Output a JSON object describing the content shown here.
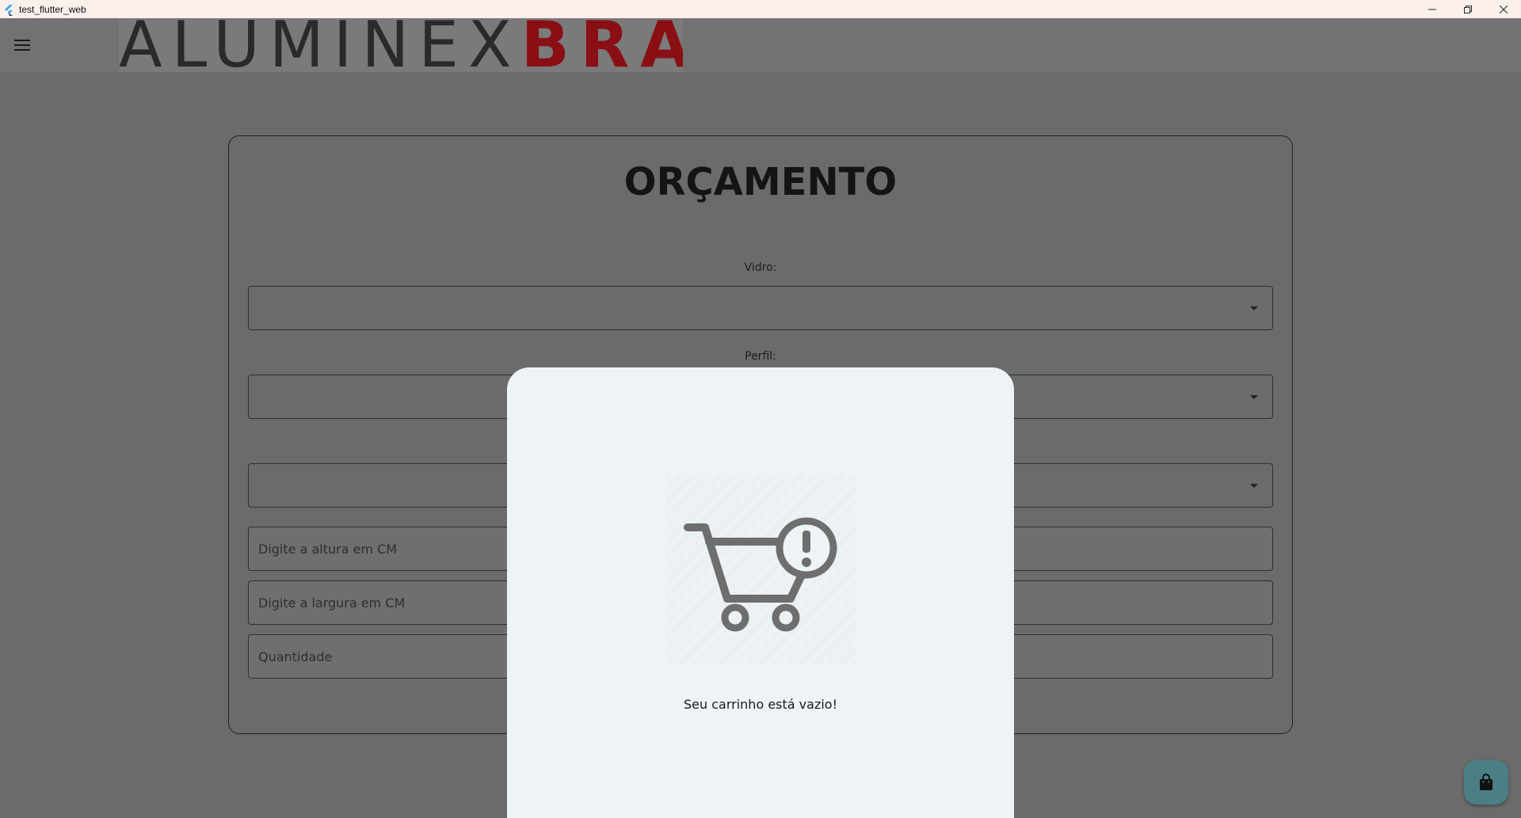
{
  "window": {
    "title": "test_flutter_web",
    "app_icon": "flutter-icon",
    "controls": [
      "minimize-icon",
      "restore-icon",
      "close-icon"
    ]
  },
  "appbar": {
    "menu_icon": "hamburger-menu-icon",
    "logo": {
      "part1": "ALUMINEX",
      "part2": "BRASIL"
    }
  },
  "form": {
    "title": "ORÇAMENTO",
    "vidro_label": "Vidro:",
    "perfil_label": "Perfil:",
    "altura_placeholder": "Digite a altura em CM",
    "largura_placeholder": "Digite a largura em CM",
    "quantidade_placeholder": "Quantidade"
  },
  "cart_sheet": {
    "icon": "empty-cart-alert-icon",
    "message": "Seu carrinho está vazio!"
  },
  "fab": {
    "icon": "shopping-bag-icon"
  },
  "colors": {
    "scrim": "#6b6b6b",
    "sheet_bg": "#eef3f5",
    "logo_red": "#8a0f14",
    "fab_bg": "#4a7f86"
  }
}
